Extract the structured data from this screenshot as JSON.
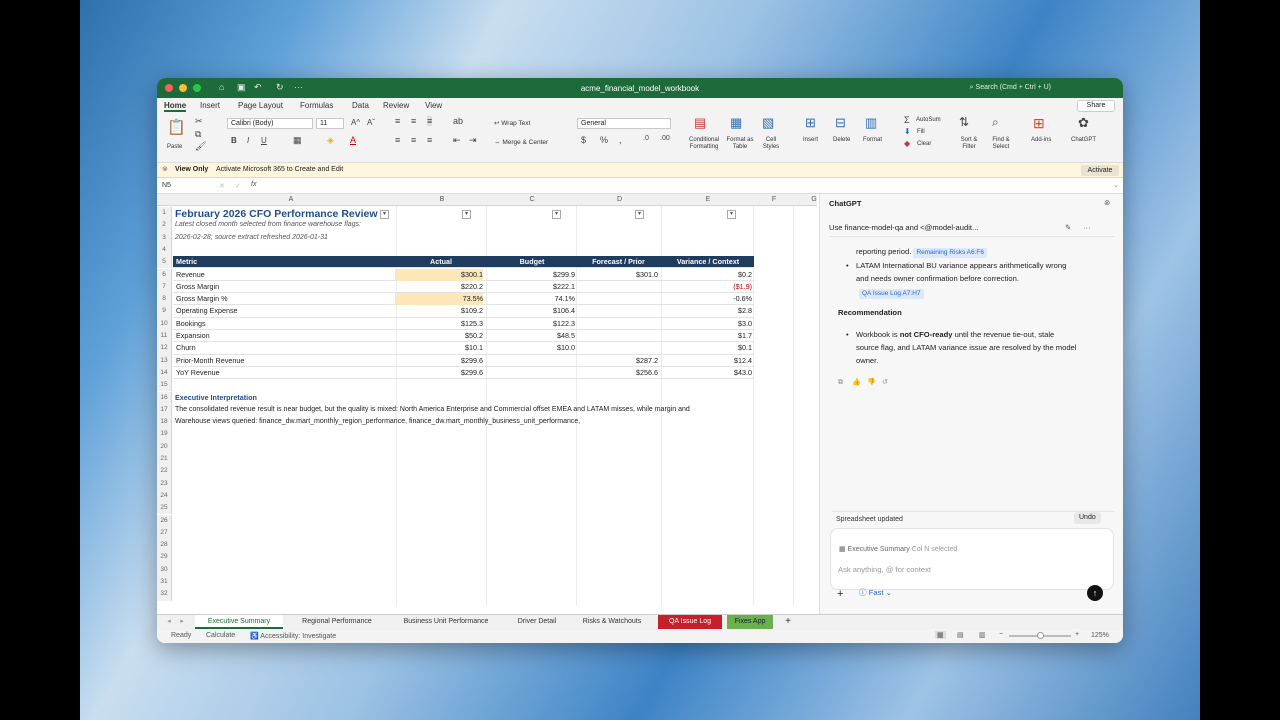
{
  "window": {
    "title": "acme_financial_model_workbook",
    "search": "Search (Cmd + Ctrl + U)"
  },
  "menu": {
    "items": [
      "Home",
      "Insert",
      "Page Layout",
      "Formulas",
      "Data",
      "Review",
      "View"
    ],
    "share": "Share"
  },
  "ribbon": {
    "paste": "Paste",
    "font": "Calibri (Body)",
    "size": "11",
    "wrap": "Wrap Text",
    "merge": "Merge & Center",
    "format": "General",
    "cond": "Conditional Formatting",
    "fmt_table": "Format as Table",
    "cell_styles": "Cell Styles",
    "insert": "Insert",
    "delete": "Delete",
    "format_btn": "Format",
    "autosum": "AutoSum",
    "fill": "Fill",
    "clear": "Clear",
    "sort": "Sort & Filter",
    "find": "Find & Select",
    "addins": "Add-ins",
    "chatgpt": "ChatGPT"
  },
  "notice": {
    "title": "View Only",
    "text": "Activate Microsoft 365 to Create and Edit",
    "button": "Activate"
  },
  "formula_bar": {
    "cell": "N5",
    "fx": "fx"
  },
  "columns": [
    "A",
    "B",
    "C",
    "D",
    "E",
    "F",
    "G"
  ],
  "sheet": {
    "title": "February 2026 CFO Performance Review",
    "subtitle1": "Latest closed month selected from finance warehouse flags:",
    "subtitle2": "2026-02-28; source extract refreshed 2026-01-31",
    "headers": [
      "Metric",
      "Actual",
      "Budget",
      "Forecast / Prior",
      "Variance / Context"
    ],
    "rows": [
      [
        "Revenue",
        "$300.1",
        "$299.9",
        "$301.0",
        "$0.2"
      ],
      [
        "Gross Margin",
        "$220.2",
        "$222.1",
        "",
        "($1.9)"
      ],
      [
        "Gross Margin %",
        "73.5%",
        "74.1%",
        "",
        "-0.6%"
      ],
      [
        "Operating Expense",
        "$109.2",
        "$106.4",
        "",
        "$2.8"
      ],
      [
        "Bookings",
        "$125.3",
        "$122.3",
        "",
        "$3.0"
      ],
      [
        "Expansion",
        "$50.2",
        "$48.5",
        "",
        "$1.7"
      ],
      [
        "Churn",
        "$10.1",
        "$10.0",
        "",
        "$0.1"
      ],
      [
        "Prior-Month Revenue",
        "$299.6",
        "",
        "$287.2",
        "$12.4"
      ],
      [
        "YoY Revenue",
        "$299.6",
        "",
        "$256.6",
        "$43.0"
      ]
    ],
    "section": "Executive Interpretation",
    "line17": "The consolidated revenue result is near budget, but the quality is mixed: North America Enterprise and Commercial offset EMEA and LATAM misses, while margin and",
    "line18": "Warehouse views queried: finance_dw.mart_monthly_region_performance, finance_dw.mart_monthly_business_unit_performance,",
    "row_numbers": [
      "1",
      "2",
      "3",
      "4",
      "5",
      "6",
      "7",
      "8",
      "9",
      "10",
      "11",
      "12",
      "13",
      "14",
      "15",
      "16",
      "17",
      "18",
      "19",
      "20",
      "21",
      "22",
      "23",
      "24",
      "25",
      "26",
      "27",
      "28",
      "29",
      "30",
      "31",
      "32"
    ]
  },
  "chat": {
    "title": "ChatGPT",
    "thread": "Use finance-model-qa and <@model-audit...",
    "partial": "reporting period.",
    "tag1": "Remaining Risks A6:F6",
    "bullet1a": "LATAM International BU variance appears arithmetically wrong",
    "bullet1b": "and needs owner confirmation before correction.",
    "tag2": "QA Issue Log A7:H7",
    "rec_title": "Recommendation",
    "rec_a1": "Workbook is ",
    "rec_bold": "not CFO-ready",
    "rec_a2": " until the revenue tie-out, stale",
    "rec_b": "source flag, and LATAM variance issue are resolved by the model",
    "rec_c": "owner.",
    "updated": "Spreadsheet updated",
    "undo": "Undo",
    "context_sheet": "Executive Summary",
    "context_sel": "Col N selected",
    "placeholder": "Ask anything, @ for context",
    "mode": "Fast"
  },
  "tabs": [
    "Executive Summary",
    "Regional Performance",
    "Business Unit Performance",
    "Driver Detail",
    "Risks & Watchouts",
    "QA Issue Log",
    "Fixes App"
  ],
  "status": {
    "ready": "Ready",
    "calc": "Calculate",
    "access": "Accessibility: Investigate",
    "zoom": "125%"
  }
}
